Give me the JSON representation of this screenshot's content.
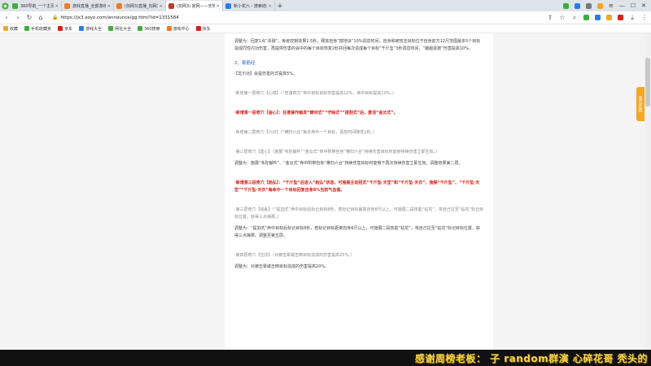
{
  "browser": {
    "tabs": [
      {
        "title": "360导航_一个主页，整个世界",
        "color": "#3fae3b",
        "active": false
      },
      {
        "title": "游戏直播_全部游戏直播_斗鱼直播",
        "color": "#f07b20",
        "active": false
      },
      {
        "title": "(剑网3)直播_剑网3直播间推荐",
        "color": "#f07b20",
        "active": false
      },
      {
        "title": "(剑网3) 官网——天地代剑",
        "color": "#c0392b",
        "active": true
      },
      {
        "title": "新小花六 - 搜索结果 - 头条搜索",
        "color": "#2b7de9",
        "active": false
      }
    ],
    "new_tab": "+",
    "url": "https://jx3.xoyo.com/announce/gg.html?id=1331584",
    "bookmarks": [
      {
        "label": "收藏",
        "color": "#f5a623"
      },
      {
        "label": "手机收藏夹",
        "color": "#3fae3b"
      },
      {
        "label": "京东",
        "color": "#d8201a"
      },
      {
        "label": "游戏大全",
        "color": "#2b7de9"
      },
      {
        "label": "网址大全",
        "color": "#3fae3b"
      },
      {
        "label": "360搜索",
        "color": "#3fae3b"
      },
      {
        "label": "游戏中心",
        "color": "#f07b20"
      },
      {
        "label": "京东",
        "color": "#d8201a"
      }
    ]
  },
  "article": {
    "p1": "调整为：回复1点“杀戮”，免疫控制效果1.5秒，释放自身“撼地诀”10%调息时间，自身和被攻击目标位于自身前方12尺范围最多5个目标造成同性内功伤害，再提供伤害的会中的每个目标恢复2秒并回每次造成每个目标“千斤坠”3秒调息时间，“蹑履逐旅”伤害提高10%。",
    "heading": "2、易筋经",
    "p2": "·【龙爪功】会提伤害的式提高5%。",
    "p3": "·新增第一层奇穴【心镜】（“普渡四方”命中目标目标伤害提高10%，命中目标提高10%。）",
    "p4": "·新增第一层奇穴【金心】：任意操作触发“摩诃式”“守缺式”“提割式”后，激活“金云式”。",
    "p5": "·新增第二层奇穴【六识】（“横扫六合”每多命中一个目标，调息时间降低1秒。）",
    "p6": "·第三层奇穴【善心】（施展“韦陀献杵”“金云式”命中附带自身“横扫六合”持续伤害目标时能使持续伤害立即生效。）",
    "p7": "调整为：施展“韦陀献杵”、“金云式”命中附带自身“横扫六合”持续伤害目标时能够下再次持续伤害立即生效。调整效果第二层。",
    "p8": "·新增第三层奇穴【焰弘】：“千斤坠”后进入“焰弘”状态，可施展主动招式“千斤坠·天罡”和“千斤坠·天衣”，施展“千斤坠”、“千斤坠·天罡”“千斤坠·天衣”每命中一个目标回复自身8%当前气血值。",
    "p9": "·第三层奇穴【铭乱】（“提割式”命中目标后标记目标8秒，若标记目标最高自身8尺以上，可施展二段技能“钻花”，将自己拉至“钻花”标记目标位置，获得三点禅那。）",
    "p10": "调整为：“提割式”命中目标后标记目标8秒，若标记目标距离自身6尺以上，可施展二段技能“钻花”，将自己拉至“钻花”标记目标位置，获得三点禅那。调整至第五层。",
    "p11": "·第四层奇穴【空识】（对被击晕或击倒目标造成的伤害提高25%。）",
    "p12": "调整为：对被击晕或击倒目标造成的伤害提高20%。"
  },
  "sidebar_tab": "意见反馈",
  "overlay": {
    "text": "感谢周榜老板：  子    random群演    心碎花哥    秃头的"
  }
}
